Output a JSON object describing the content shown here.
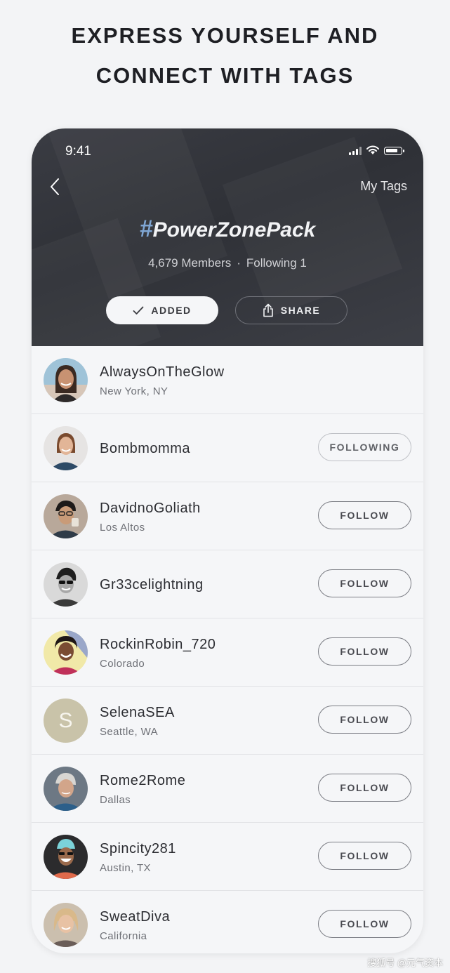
{
  "headline": {
    "line1": "EXPRESS YOURSELF AND",
    "line2": "CONNECT WITH TAGS"
  },
  "status_bar": {
    "time": "9:41",
    "icons": [
      "signal-icon",
      "wifi-icon",
      "battery-icon"
    ]
  },
  "nav": {
    "back_icon": "chevron-left-icon",
    "right_link": "My Tags"
  },
  "tag": {
    "hash": "#",
    "name": "PowerZonePack",
    "members": "4,679 Members",
    "separator": "·",
    "following": "Following 1",
    "hash_color": "#7fa6d3"
  },
  "actions": {
    "added_label": "ADDED",
    "added_icon": "checkmark-icon",
    "share_label": "SHARE",
    "share_icon": "share-icon"
  },
  "members": [
    {
      "name": "AlwaysOnTheGlow",
      "location": "New York, NY",
      "button": ""
    },
    {
      "name": "Bombmomma",
      "location": "",
      "button": "FOLLOWING"
    },
    {
      "name": "DavidnoGoliath",
      "location": "Los Altos",
      "button": "FOLLOW"
    },
    {
      "name": "Gr33celightning",
      "location": "",
      "button": "FOLLOW"
    },
    {
      "name": "RockinRobin_720",
      "location": "Colorado",
      "button": "FOLLOW"
    },
    {
      "name": "SelenaSEA",
      "location": "Seattle, WA",
      "button": "FOLLOW",
      "avatar_letter": "S"
    },
    {
      "name": "Rome2Rome",
      "location": "Dallas",
      "button": "FOLLOW"
    },
    {
      "name": "Spincity281",
      "location": "Austin, TX",
      "button": "FOLLOW"
    },
    {
      "name": "SweatDiva",
      "location": "California",
      "button": "FOLLOW"
    }
  ],
  "watermark": "搜狐号 @元气资本"
}
